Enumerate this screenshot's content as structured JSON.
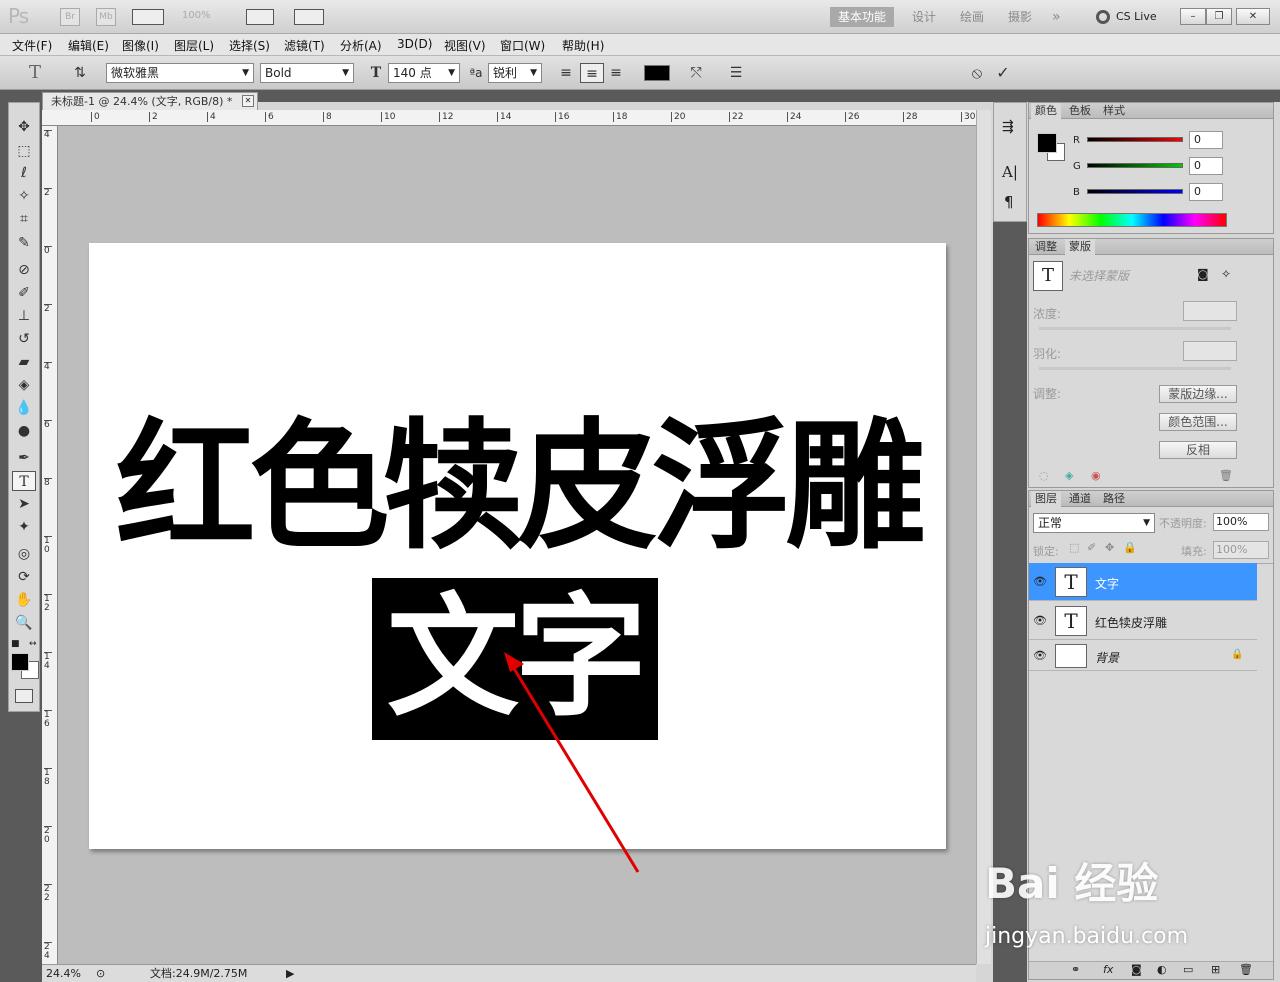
{
  "appbar": {
    "logo": "Ps",
    "bridge": "Br",
    "minibridge": "Mb",
    "zoom": "100%",
    "workspaces": [
      "基本功能",
      "设计",
      "绘画",
      "摄影"
    ],
    "more": "»",
    "cslive": "CS Live",
    "window_buttons": [
      "–",
      "❐",
      "✕"
    ]
  },
  "menubar": [
    "文件(F)",
    "编辑(E)",
    "图像(I)",
    "图层(L)",
    "选择(S)",
    "滤镜(T)",
    "分析(A)",
    "3D(D)",
    "视图(V)",
    "窗口(W)",
    "帮助(H)"
  ],
  "options": {
    "font_family": "微软雅黑",
    "font_style": "Bold",
    "font_size": "140 点",
    "aa_label": "ªa",
    "antialias": "锐利",
    "cancel": "⦸",
    "commit": "✓",
    "text_color": "#000000"
  },
  "document": {
    "tab_title": "未标题-1 @ 24.4% (文字, RGB/8) *",
    "close": "✕",
    "ruler_h": [
      "0",
      "2",
      "4",
      "6",
      "8",
      "10",
      "12",
      "14",
      "16",
      "18",
      "20",
      "22",
      "24",
      "26",
      "28",
      "30"
    ],
    "ruler_v": [
      "4",
      "2",
      "0",
      "2",
      "4",
      "6",
      "8",
      "1 0",
      "1 2",
      "1 4",
      "1 6",
      "1 8",
      "2 0",
      "2 2",
      "2 4"
    ],
    "line1": "红色犊皮浮雕",
    "line2": "文字"
  },
  "status": {
    "zoom": "24.4%",
    "doc": "文档:24.9M/2.75M"
  },
  "color_panel": {
    "tabs": [
      "颜色",
      "色板",
      "样式"
    ],
    "channels": [
      {
        "label": "R",
        "value": "0"
      },
      {
        "label": "G",
        "value": "0"
      },
      {
        "label": "B",
        "value": "0"
      }
    ]
  },
  "masks_panel": {
    "tabs": [
      "调整",
      "蒙版"
    ],
    "no_mask": "未选择蒙版",
    "density": "浓度:",
    "feather": "羽化:",
    "refine": "调整:",
    "buttons": [
      "蒙版边缘...",
      "颜色范围...",
      "反相"
    ]
  },
  "layers_panel": {
    "tabs": [
      "图层",
      "通道",
      "路径"
    ],
    "blend_mode": "正常",
    "opacity_label": "不透明度:",
    "opacity": "100%",
    "lock_label": "锁定:",
    "fill_label": "填充:",
    "fill": "100%",
    "layers": [
      {
        "name": "文字",
        "thumb": "T"
      },
      {
        "name": "红色犊皮浮雕",
        "thumb": "T"
      },
      {
        "name": "背景",
        "thumb": ""
      }
    ],
    "footer_icons": [
      "⚭",
      "fx",
      "◙",
      "◐",
      "▭",
      "⊞",
      "🗑"
    ]
  },
  "watermark": {
    "brand": "Bai 经验",
    "url": "jingyan.baidu.com"
  }
}
